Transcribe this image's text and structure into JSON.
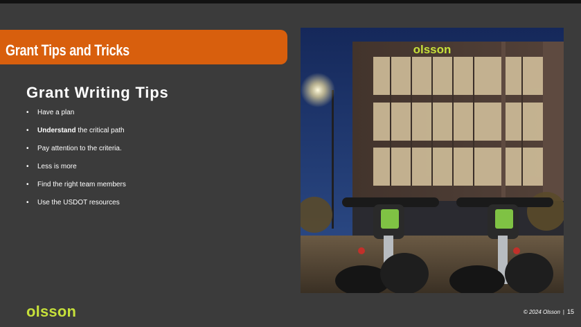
{
  "slide": {
    "title": "Grant Tips and Tricks",
    "heading": "Grant Writing Tips",
    "bullet_char": "•",
    "tips": [
      {
        "bold": "",
        "text": "Have a plan"
      },
      {
        "bold": "Understand",
        "text": " the critical path"
      },
      {
        "bold": "",
        "text": "Pay attention to the criteria."
      },
      {
        "bold": "",
        "text": "Less is more"
      },
      {
        "bold": "",
        "text": "Find the right team members"
      },
      {
        "bold": "",
        "text": "Use the USDOT resources"
      }
    ],
    "photo_sign": "olsson",
    "logo": "olsson",
    "copyright": "© 2024 Olsson",
    "page_separator": "|",
    "page_number": "15"
  },
  "colors": {
    "background": "#3b3b3b",
    "title_bar": "#d85f0d",
    "logo_green": "#c6e03a"
  }
}
